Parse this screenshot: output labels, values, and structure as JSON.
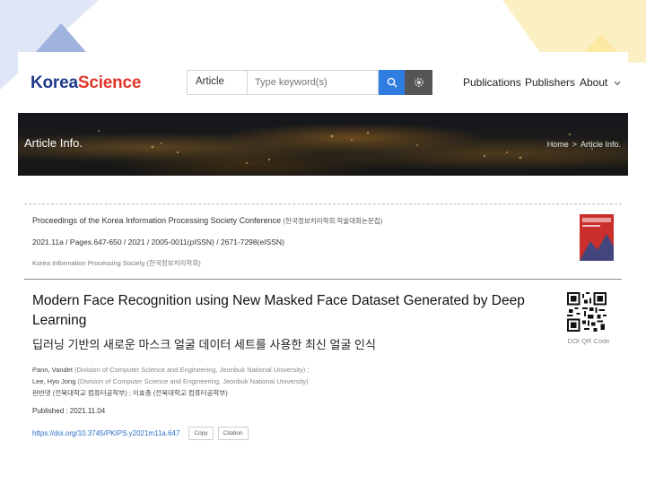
{
  "header": {
    "logo_part1": "Korea",
    "logo_part2": "Science",
    "search": {
      "category": "Article",
      "placeholder": "Type keyword(s)"
    },
    "nav": {
      "publications": "Publications",
      "publishers": "Publishers",
      "about": "About"
    }
  },
  "banner": {
    "title": "Article Info.",
    "breadcrumb": {
      "home": "Home",
      "separator": ">",
      "current": "Article Info."
    }
  },
  "article": {
    "journal": "Proceedings of the Korea Information Processing Society Conference",
    "journal_ko": "(한국정보처리학회:학술대회논문집)",
    "meta": "2021.11a  /  Pages.647-650  /  2021  /  2005-0011(pISSN)  /  2671-7298(eISSN)",
    "publisher": "Korea Information Processing Society (한국정보처리학회)",
    "title_en": "Modern Face Recognition using New Masked Face Dataset Generated by Deep Learning",
    "title_ko": "딥러닝 기반의 새로운 마스크 얼굴 데이터 세트를 사용한 최신 얼굴 인식",
    "qr_label": "DOI QR Code",
    "authors": [
      {
        "name": "Pann, Vandet",
        "affiliation": "(Division of Computer Science and Engineering, Jeonbuk National University) ;"
      },
      {
        "name": "Lee, Hyo Jong",
        "affiliation": "(Division of Computer Science and Engineering, Jeonbuk National University)"
      }
    ],
    "authors_ko": "판반댓 (전북대학교 컴퓨터공학부) ;  이효종 (전북대학교 컴퓨터공학부)",
    "published": "Published : 2021.11.04",
    "doi": "https://doi.org/10.3745/PKIPS.y2021m11a.647",
    "copy_label": "Copy",
    "citation_label": "Citation"
  },
  "colors": {
    "brand_blue": "#1f3a8a",
    "brand_red": "#e0352b",
    "search_button": "#2f7de1",
    "link": "#2a6fc9"
  }
}
